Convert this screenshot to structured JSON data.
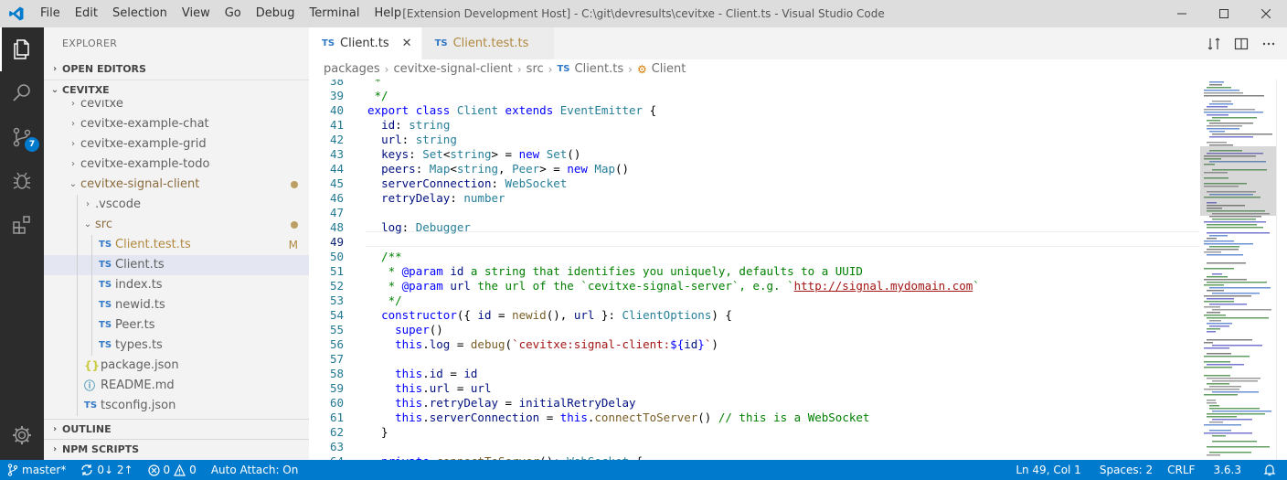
{
  "titlebar": {
    "menu": [
      "File",
      "Edit",
      "Selection",
      "View",
      "Go",
      "Debug",
      "Terminal",
      "Help"
    ],
    "window_title": "[Extension Development Host] - C:\\git\\devresults\\cevitxe - Client.ts - Visual Studio Code"
  },
  "activity": {
    "scm_badge": "7",
    "icons": [
      "files-icon",
      "search-icon",
      "source-control-icon",
      "debug-icon",
      "extensions-icon",
      "settings-gear-icon"
    ]
  },
  "sidebar": {
    "title": "EXPLORER",
    "open_editors": "OPEN EDITORS",
    "workspace": "CEVITXE",
    "tree": [
      {
        "label": "cevitxe",
        "depth": 1,
        "twistie": "›",
        "partial": true
      },
      {
        "label": "cevitxe-example-chat",
        "depth": 1,
        "twistie": "›"
      },
      {
        "label": "cevitxe-example-grid",
        "depth": 1,
        "twistie": "›"
      },
      {
        "label": "cevitxe-example-todo",
        "depth": 1,
        "twistie": "›"
      },
      {
        "label": "cevitxe-signal-client",
        "depth": 1,
        "twistie": "⌄",
        "dirty": true
      },
      {
        "label": ".vscode",
        "depth": 2,
        "twistie": "›"
      },
      {
        "label": "src",
        "depth": 2,
        "twistie": "⌄",
        "dirty": true
      },
      {
        "label": "Client.test.ts",
        "depth": 3,
        "icon": "TS",
        "deco": "M",
        "modified": true
      },
      {
        "label": "Client.ts",
        "depth": 3,
        "icon": "TS",
        "selected": true
      },
      {
        "label": "index.ts",
        "depth": 3,
        "icon": "TS"
      },
      {
        "label": "newid.ts",
        "depth": 3,
        "icon": "TS"
      },
      {
        "label": "Peer.ts",
        "depth": 3,
        "icon": "TS"
      },
      {
        "label": "types.ts",
        "depth": 3,
        "icon": "TS"
      },
      {
        "label": "package.json",
        "depth": 2,
        "icon": "{}"
      },
      {
        "label": "README.md",
        "depth": 2,
        "icon": "ⓘ"
      },
      {
        "label": "tsconfig.json",
        "depth": 2,
        "icon": "TS"
      }
    ],
    "outline": "OUTLINE",
    "npm_scripts": "NPM SCRIPTS"
  },
  "editor": {
    "tabs": [
      {
        "label": "Client.ts",
        "active": true
      },
      {
        "label": "Client.test.ts",
        "active": false
      }
    ],
    "breadcrumbs": [
      "packages",
      "cevitxe-signal-client",
      "src",
      "Client.ts",
      "Client"
    ],
    "first_line": 38,
    "current_line": 49
  },
  "statusbar": {
    "branch": "master*",
    "sync": "0↓ 2↑",
    "errors": "0",
    "warnings": "0",
    "auto_attach": "Auto Attach: On",
    "position": "Ln 49, Col 1",
    "spaces": "Spaces: 2",
    "eol": "CRLF",
    "version": "3.6.3"
  },
  "colors": {
    "statusbar": "#007acc",
    "activitybar": "#2c2c2c",
    "sidebar": "#f3f3f3",
    "modified": "#b0893e"
  }
}
